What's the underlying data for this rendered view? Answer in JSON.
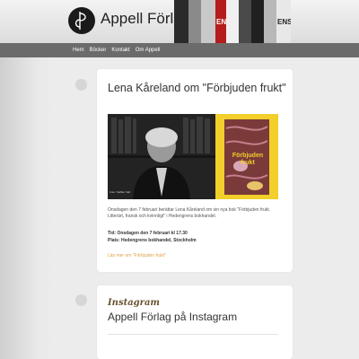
{
  "header": {
    "site_title": "Appell Förlag",
    "banner_covers": [
      "#2a2a2a",
      "#8a8a8a",
      "#c9c9c9",
      "#b51d1d",
      "#f0f0f0",
      "#4a4a4a",
      "#202020",
      "#b8b8b8",
      "#e8e8e8"
    ],
    "banner_letters": [
      "EN",
      "ENS"
    ]
  },
  "nav": {
    "items": [
      "Hem",
      "Böcker",
      "Kontakt",
      "Om Appell"
    ]
  },
  "post": {
    "title": "Lena Kåreland om \"Förbjuden frukt\"",
    "image_caption": "Foto: Staffan Sall",
    "book_cover_text": "Förbjuden frukt",
    "intro": "Onsdagen den 7 februari berättar Lena Kåreland om sin nya bok \"Förbjuden frukt. Litterärt, fransk och kvinnligt\" i Hedengrens bokhandel.",
    "time": "Tid: Onsdagen den 7 februari kl 17.30",
    "place": "Plats: Hedengrens bokhandel, Stockholm",
    "read_more": "Läs mer om \"Förbjuden frukt\""
  },
  "instagram": {
    "script_label": "Instagram",
    "title": "Appell Förlag på Instagram"
  },
  "colors": {
    "accent": "#e0a04a",
    "nav_bg": "#6b6b6b",
    "book_bg": "#f2cf2a"
  }
}
